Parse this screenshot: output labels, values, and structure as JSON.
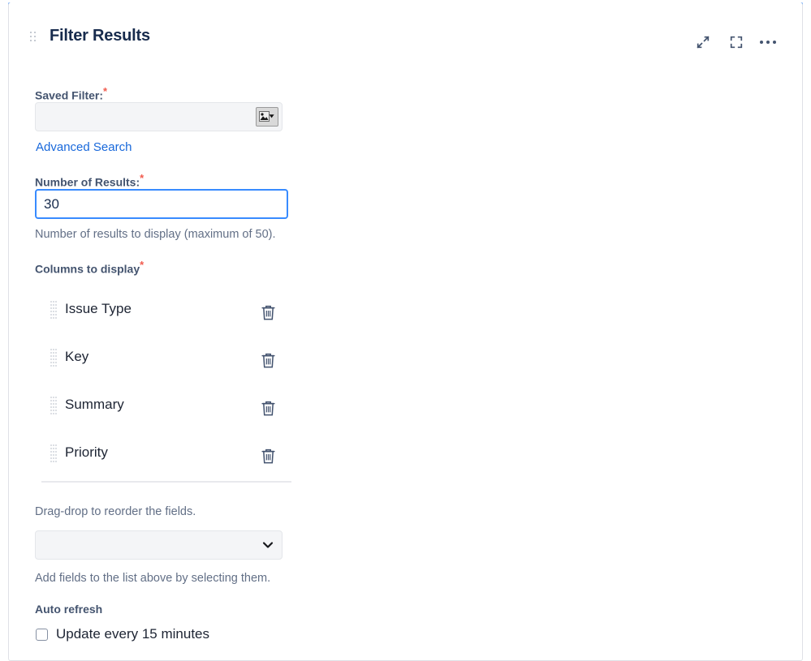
{
  "gadget": {
    "title": "Filter Results",
    "accent_color": "#2684ff",
    "drag_handle_icon": "drag-dots-icon",
    "header_actions": [
      {
        "name": "collapse-icon",
        "label": "Collapse"
      },
      {
        "name": "maximize-icon",
        "label": "Maximize"
      },
      {
        "name": "more-options-icon",
        "label": "More"
      }
    ]
  },
  "form": {
    "saved_filter": {
      "label": "Saved Filter:",
      "required_marker": "*",
      "value": "",
      "placeholder": "",
      "picker_icon": "image-picker-icon"
    },
    "advanced_search": {
      "label": "Advanced Search",
      "color": "#1868db"
    },
    "number_of_results": {
      "label": "Number of Results:",
      "required_marker": "*",
      "value": "30",
      "help": "Number of results to display (maximum of 50).",
      "focus_color": "#388bff"
    },
    "columns": {
      "label": "Columns to display",
      "required_marker": "*",
      "items": [
        {
          "name": "Issue Type",
          "drag_icon": "drag-dots-icon",
          "delete_icon": "trash-icon"
        },
        {
          "name": "Key",
          "drag_icon": "drag-dots-icon",
          "delete_icon": "trash-icon"
        },
        {
          "name": "Summary",
          "drag_icon": "drag-dots-icon",
          "delete_icon": "trash-icon"
        },
        {
          "name": "Priority",
          "drag_icon": "drag-dots-icon",
          "delete_icon": "trash-icon"
        }
      ],
      "reorder_help": "Drag-drop to reorder the fields."
    },
    "add_field": {
      "value": "",
      "options": [
        ""
      ],
      "chevron_icon": "chevron-down-icon",
      "help": "Add fields to the list above by selecting them."
    },
    "auto_refresh": {
      "label": "Auto refresh",
      "checkbox_label": "Update every 15 minutes",
      "checked": false
    }
  }
}
